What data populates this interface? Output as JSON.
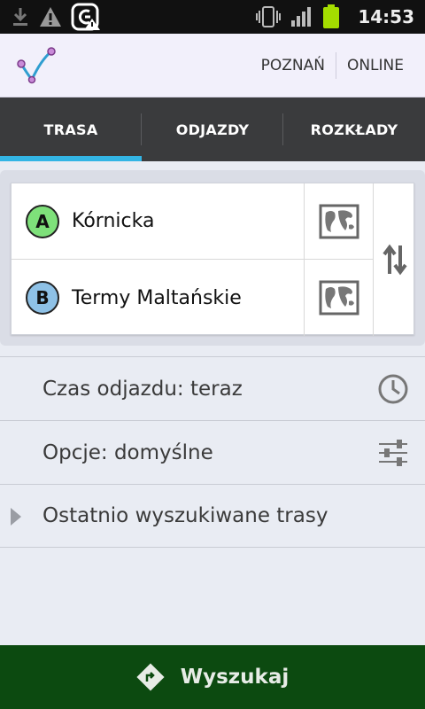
{
  "status_bar": {
    "time": "14:53",
    "icons": [
      "download-icon",
      "warning-icon",
      "app-notification-icon",
      "vibrate-icon",
      "signal-icon",
      "battery-icon"
    ]
  },
  "header": {
    "logo": "route-logo-icon",
    "city": "POZNAŃ",
    "mode": "ONLINE"
  },
  "tabs": [
    {
      "label": "TRASA",
      "active": true
    },
    {
      "label": "ODJAZDY",
      "active": false
    },
    {
      "label": "ROZKŁADY",
      "active": false
    }
  ],
  "route": {
    "from": {
      "badge": "A",
      "name": "Kórnicka"
    },
    "to": {
      "badge": "B",
      "name": "Termy Maltańskie"
    },
    "map_icon": "map-icon",
    "swap_icon": "swap-arrows-icon"
  },
  "options": {
    "departure": "Czas odjazdu: teraz",
    "settings": "Opcje: domyślne",
    "recent": "Ostatnio wyszukiwane trasy"
  },
  "search_button": {
    "label": "Wyszukaj"
  },
  "colors": {
    "tab_indicator": "#33b5e5",
    "badge_a": "#7ee07a",
    "badge_b": "#8ec1e6",
    "search_bar": "#0c4a10"
  }
}
